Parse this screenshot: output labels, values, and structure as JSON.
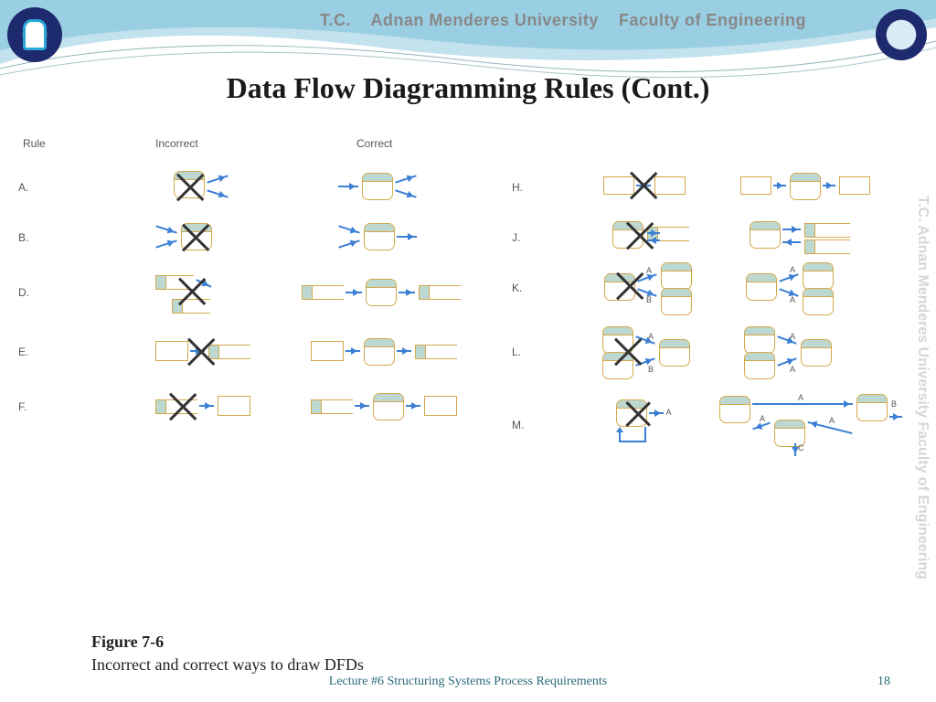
{
  "header": {
    "tc": "T.C.",
    "university": "Adnan Menderes University",
    "faculty": "Faculty of Engineering"
  },
  "title": "Data Flow Diagramming Rules (Cont.)",
  "columns": {
    "rule": "Rule",
    "incorrect": "Incorrect",
    "correct": "Correct"
  },
  "rules_left": [
    "A.",
    "B.",
    "D.",
    "E.",
    "F."
  ],
  "rules_right": [
    "H.",
    "J.",
    "K.",
    "L.",
    "M."
  ],
  "flow_labels": {
    "a": "A",
    "b": "B",
    "c": "C"
  },
  "caption": {
    "figure": "Figure 7-6",
    "text": "Incorrect and correct ways to draw DFDs"
  },
  "footer": "Lecture #6 Structuring Systems Process Requirements",
  "page": "18",
  "watermark": "T.C.   Adnan Menderes University   Faculty of Engineering"
}
